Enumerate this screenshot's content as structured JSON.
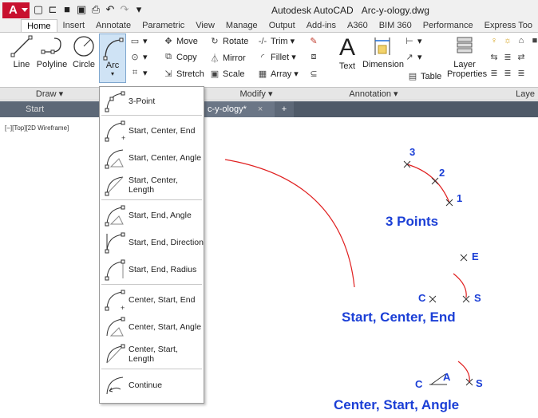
{
  "window": {
    "app_title": "Autodesk AutoCAD",
    "file_title": "Arc-y-ology.dwg"
  },
  "app_logo": "A",
  "ribbon_tabs": [
    "Home",
    "Insert",
    "Annotate",
    "Parametric",
    "View",
    "Manage",
    "Output",
    "Add-ins",
    "A360",
    "BIM 360",
    "Performance",
    "Express Too"
  ],
  "draw": {
    "line": "Line",
    "polyline": "Polyline",
    "circle": "Circle",
    "arc": "Arc",
    "panel": "Draw ▾"
  },
  "modify": {
    "move": "Move",
    "rotate": "Rotate",
    "trim": "Trim",
    "copy": "Copy",
    "mirror": "Mirror",
    "fillet": "Fillet",
    "stretch": "Stretch",
    "scale": "Scale",
    "array": "Array",
    "panel": "Modify ▾"
  },
  "annotation": {
    "text": "Text",
    "dimension": "Dimension",
    "table": "Table",
    "panel": "Annotation ▾"
  },
  "layers": {
    "layer_properties_1": "Layer",
    "layer_properties_2": "Properties",
    "panel": "Laye"
  },
  "doc_tabs": {
    "start": "Start",
    "active": "c-y-ology*",
    "close": "×",
    "plus": "+"
  },
  "viewport_label": "[−][Top][2D Wireframe]",
  "arc_menu": [
    "3-Point",
    "Start, Center, End",
    "Start, Center, Angle",
    "Start, Center, Length",
    "Start, End, Angle",
    "Start, End, Direction",
    "Start, End, Radius",
    "Center, Start, End",
    "Center, Start, Angle",
    "Center, Start, Length",
    "Continue"
  ],
  "canvas_labels": {
    "p3": "3",
    "p2": "2",
    "p1": "1",
    "three_points": "3 Points",
    "e": "E",
    "c1": "C",
    "s1": "S",
    "sce": "Start, Center, End",
    "c2": "C",
    "a": "A",
    "s2": "S",
    "csa": "Center, Start, Angle"
  },
  "colors": {
    "accent_blue": "#1b3fd6",
    "arc_red": "#e02020",
    "logo_red": "#c8102e",
    "tab_dark": "#4f5a68"
  }
}
